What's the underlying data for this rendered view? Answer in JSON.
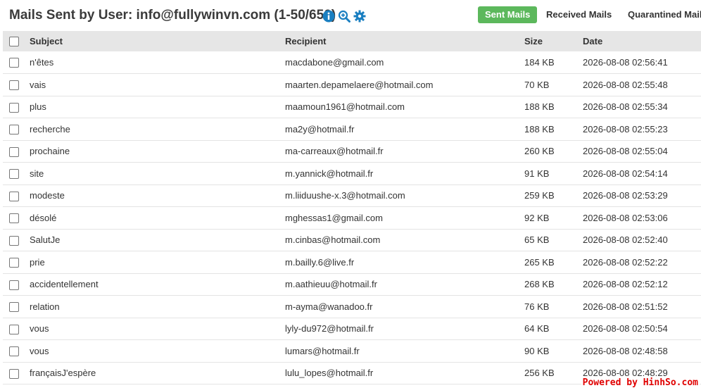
{
  "header": {
    "title": "Mails Sent by User: info@fullywinvn.com (1-50/656)",
    "icons": [
      "info-icon",
      "zoom-search-icon",
      "gear-icon"
    ],
    "tabs": [
      {
        "label": "Sent Mails",
        "active": true
      },
      {
        "label": "Received Mails",
        "active": false
      },
      {
        "label": "Quarantined Mails",
        "active": false
      }
    ]
  },
  "table": {
    "columns": [
      "Subject",
      "Recipient",
      "Size",
      "Date"
    ],
    "rows": [
      {
        "subject": "n'êtes",
        "recipient": "macdabone@gmail.com",
        "size": "184 KB",
        "date": "2026-08-08 02:56:41"
      },
      {
        "subject": "vais",
        "recipient": "maarten.depamelaere@hotmail.com",
        "size": "70 KB",
        "date": "2026-08-08 02:55:48"
      },
      {
        "subject": "plus",
        "recipient": "maamoun1961@hotmail.com",
        "size": "188 KB",
        "date": "2026-08-08 02:55:34"
      },
      {
        "subject": "recherche",
        "recipient": "ma2y@hotmail.fr",
        "size": "188 KB",
        "date": "2026-08-08 02:55:23"
      },
      {
        "subject": "prochaine",
        "recipient": "ma-carreaux@hotmail.fr",
        "size": "260 KB",
        "date": "2026-08-08 02:55:04"
      },
      {
        "subject": "site",
        "recipient": "m.yannick@hotmail.fr",
        "size": "91 KB",
        "date": "2026-08-08 02:54:14"
      },
      {
        "subject": "modeste",
        "recipient": "m.liiduushe-x.3@hotmail.com",
        "size": "259 KB",
        "date": "2026-08-08 02:53:29"
      },
      {
        "subject": "désolé",
        "recipient": "mghessas1@gmail.com",
        "size": "92 KB",
        "date": "2026-08-08 02:53:06"
      },
      {
        "subject": "SalutJe",
        "recipient": "m.cinbas@hotmail.com",
        "size": "65 KB",
        "date": "2026-08-08 02:52:40"
      },
      {
        "subject": "prie",
        "recipient": "m.bailly.6@live.fr",
        "size": "265 KB",
        "date": "2026-08-08 02:52:22"
      },
      {
        "subject": "accidentellement",
        "recipient": "m.aathieuu@hotmail.fr",
        "size": "268 KB",
        "date": "2026-08-08 02:52:12"
      },
      {
        "subject": "relation",
        "recipient": "m-ayma@wanadoo.fr",
        "size": "76 KB",
        "date": "2026-08-08 02:51:52"
      },
      {
        "subject": "vous",
        "recipient": "lyly-du972@hotmail.fr",
        "size": "64 KB",
        "date": "2026-08-08 02:50:54"
      },
      {
        "subject": "vous",
        "recipient": "lumars@hotmail.fr",
        "size": "90 KB",
        "date": "2026-08-08 02:48:58"
      },
      {
        "subject": "françaisJ'espère",
        "recipient": "lulu_lopes@hotmail.fr",
        "size": "256 KB",
        "date": "2026-08-08 02:48:29"
      }
    ]
  },
  "watermark": "Powered by HinhSo.com",
  "colors": {
    "accent": "#5cb85c",
    "icon": "#1a7fc1",
    "header_bg": "#e6e6e6"
  }
}
